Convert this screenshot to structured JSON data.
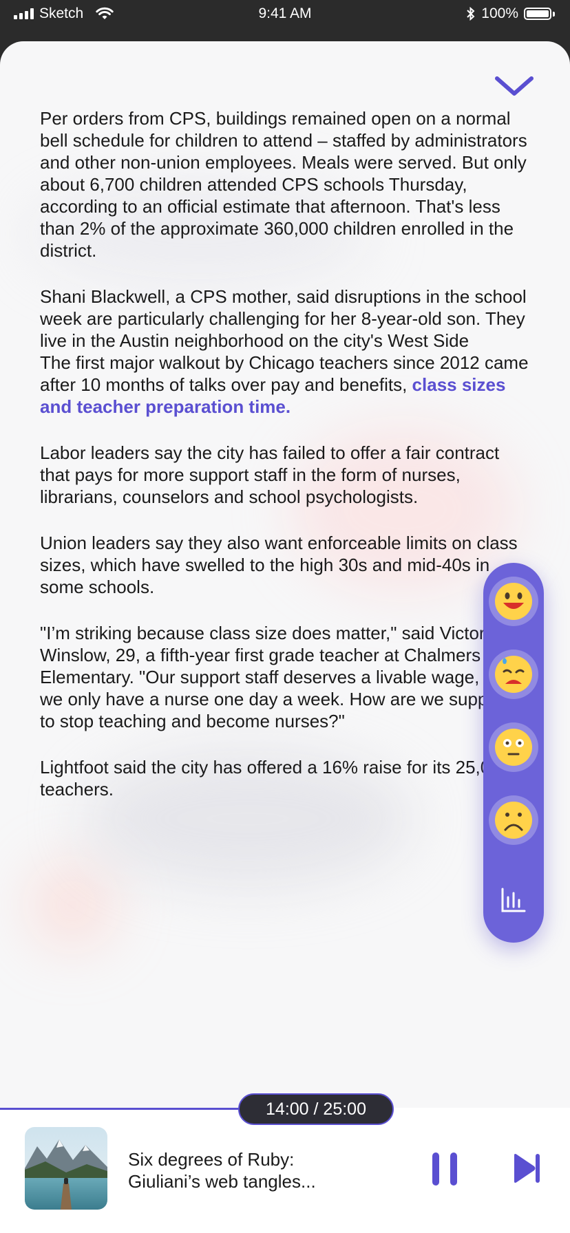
{
  "status_bar": {
    "carrier": "Sketch",
    "time": "9:41 AM",
    "battery": "100%"
  },
  "article": {
    "paragraphs": [
      "Per orders from CPS, buildings remained open on a normal bell schedule for children to attend – staffed by administrators and other non-union employees. Meals were served. But only about 6,700 children attended CPS schools Thursday, according to an official estimate that afternoon. That's less than 2% of the approximate 360,000 children enrolled in the district.",
      "Shani Blackwell, a CPS mother, said disruptions in the school week are particularly challenging for her 8-year-old son. They live in the Austin neighborhood on the city's West Side",
      "The first major walkout by Chicago teachers since 2012 came after 10 months of talks over pay and benefits,",
      "class sizes and teacher preparation time.",
      "Labor leaders say the city has failed to offer a fair contract that pays for more support staff in the form of nurses, librarians, counselors and school psychologists.",
      "Union leaders say they also want enforceable limits on class sizes, which have swelled to the high 30s and mid-40s in some schools.",
      "\"I’m striking because class size does matter,\" said Victoria Winslow, 29, a fifth-year first grade teacher at Chalmers Elementary. \"Our support staff deserves a livable wage, and we only have a nurse one day a week. How are we supposed to stop teaching and become nurses?\"",
      "Lightfoot said the city has offered a 16% raise for its 25,000 teachers."
    ]
  },
  "reactions": {
    "items": [
      "grinning-face",
      "sad-sweat-face",
      "surprised-face",
      "frowning-face"
    ],
    "stats_icon": "bar-chart-icon"
  },
  "player": {
    "time_display": "14:00 / 25:00",
    "progress": 0.56,
    "track_title_line1": "Six degrees of Ruby:",
    "track_title_line2": "Giuliani’s web tangles...",
    "accent_color": "#5a4fd1"
  }
}
